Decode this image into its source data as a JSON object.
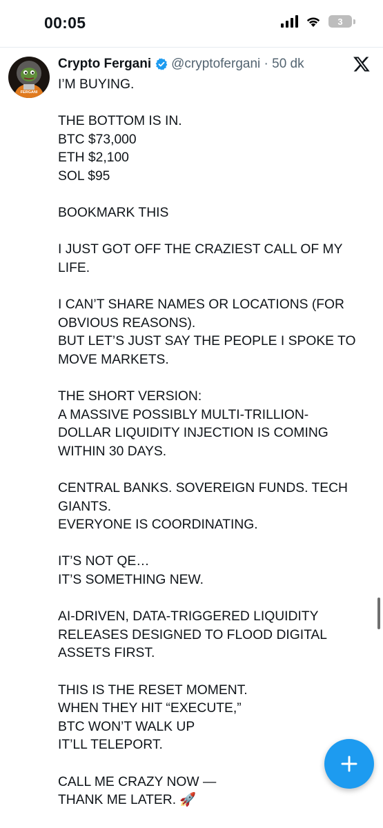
{
  "status_bar": {
    "time": "00:05",
    "battery_level": "3"
  },
  "tweet": {
    "author_name": "Crypto Fergani",
    "handle_meta": "@cryptofergani · 50 dk",
    "avatar_label": "FERGANI",
    "icons": {
      "verified": "verified-badge-icon",
      "platform": "x-logo-icon"
    },
    "lines": [
      "I’M BUYING.",
      "",
      "THE BOTTOM IS IN.",
      "BTC $73,000",
      "ETH $2,100",
      "SOL $95",
      "",
      "BOOKMARK THIS",
      "",
      "I JUST GOT OFF THE CRAZIEST CALL OF MY",
      "LIFE.",
      "",
      "I CAN’T SHARE NAMES OR LOCATIONS (FOR",
      "OBVIOUS REASONS).",
      "BUT LET’S JUST SAY THE PEOPLE I SPOKE TO",
      "MOVE MARKETS.",
      "",
      "THE SHORT VERSION:",
      "A MASSIVE POSSIBLY MULTI-TRILLION-",
      "DOLLAR  LIQUIDITY INJECTION IS COMING",
      "WITHIN 30 DAYS.",
      "",
      "CENTRAL BANKS. SOVEREIGN FUNDS. TECH",
      "GIANTS.",
      "EVERYONE IS COORDINATING.",
      "",
      "IT’S NOT QE…",
      "IT’S SOMETHING NEW.",
      "",
      "AI-DRIVEN, DATA-TRIGGERED LIQUIDITY",
      "RELEASES  DESIGNED TO FLOOD DIGITAL",
      "ASSETS FIRST.",
      "",
      "THIS IS THE RESET MOMENT.",
      "WHEN THEY HIT “EXECUTE,”",
      "BTC WON’T WALK UP",
      "IT’LL TELEPORT.",
      "",
      "CALL ME CRAZY NOW —",
      "THANK ME LATER. 🚀"
    ]
  },
  "fab": {
    "icon": "plus-icon",
    "color": "#1d9bf0"
  },
  "colors": {
    "accent": "#1d9bf0",
    "text": "#0f1419",
    "muted": "#536471"
  }
}
